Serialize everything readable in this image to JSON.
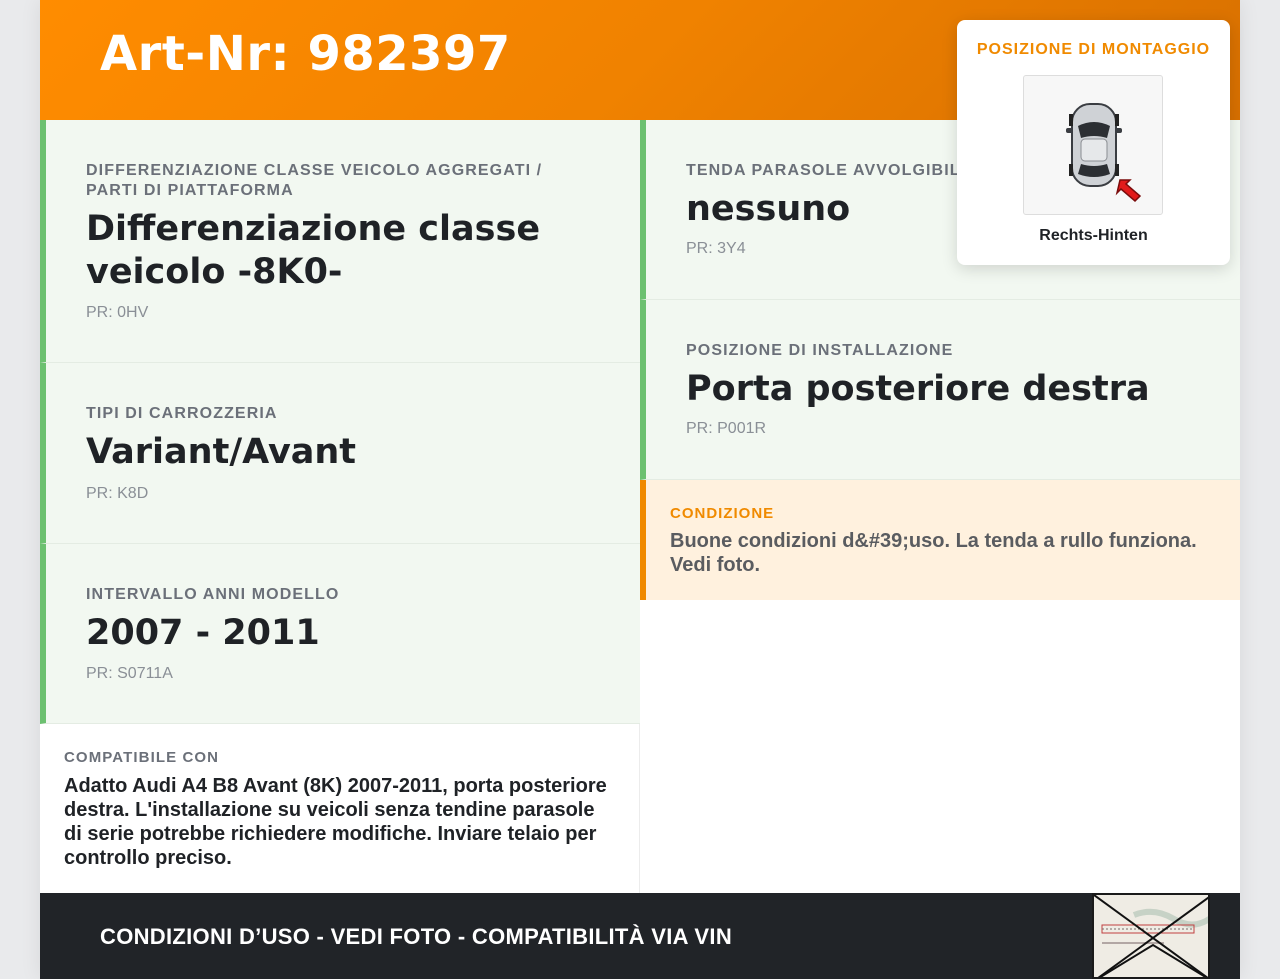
{
  "header": {
    "title": "Art-Nr: 982397"
  },
  "left_cells": [
    {
      "label": "DIFFERENZIAZIONE CLASSE VEICOLO AGGREGATI / PARTI DI PIATTAFORMA",
      "value": "Differenziazione classe veicolo -8K0-",
      "code": "PR: 0HV"
    },
    {
      "label": "TIPI DI CARROZZERIA",
      "value": "Variant/Avant",
      "code": "PR: K8D"
    },
    {
      "label": "INTERVALLO ANNI MODELLO",
      "value": "2007 - 2011",
      "code": "PR: S0711A"
    }
  ],
  "right_cells": [
    {
      "label": "TENDA PARASOLE AVVOLGIBILE",
      "value": "nessuno",
      "code": "PR: 3Y4"
    },
    {
      "label": "POSIZIONE DI INSTALLAZIONE",
      "value": "Porta posteriore destra",
      "code": "PR: P001R"
    }
  ],
  "condition": {
    "label": "CONDIZIONE",
    "text": "Buone condizioni d&#39;uso. La tenda a rullo funziona. Vedi foto."
  },
  "compat": {
    "label": "COMPATIBILE CON",
    "text": "Adatto Audi A4 B8 Avant (8K) 2007-2011, porta posteriore destra. L'installazione su veicoli senza tendine parasole di serie potrebbe richiedere modifiche. Inviare telaio per controllo preciso."
  },
  "mount": {
    "label": "POSIZIONE DI MONTAGGIO",
    "position": "Rechts-Hinten"
  },
  "footer": {
    "text": "CONDIZIONI D’USO - VEDI FOTO - COMPATIBILITÀ VIA VIN"
  },
  "colors": {
    "accent_orange": "#f08a00",
    "green_border": "#6cc070",
    "footer_bg": "#212428"
  }
}
